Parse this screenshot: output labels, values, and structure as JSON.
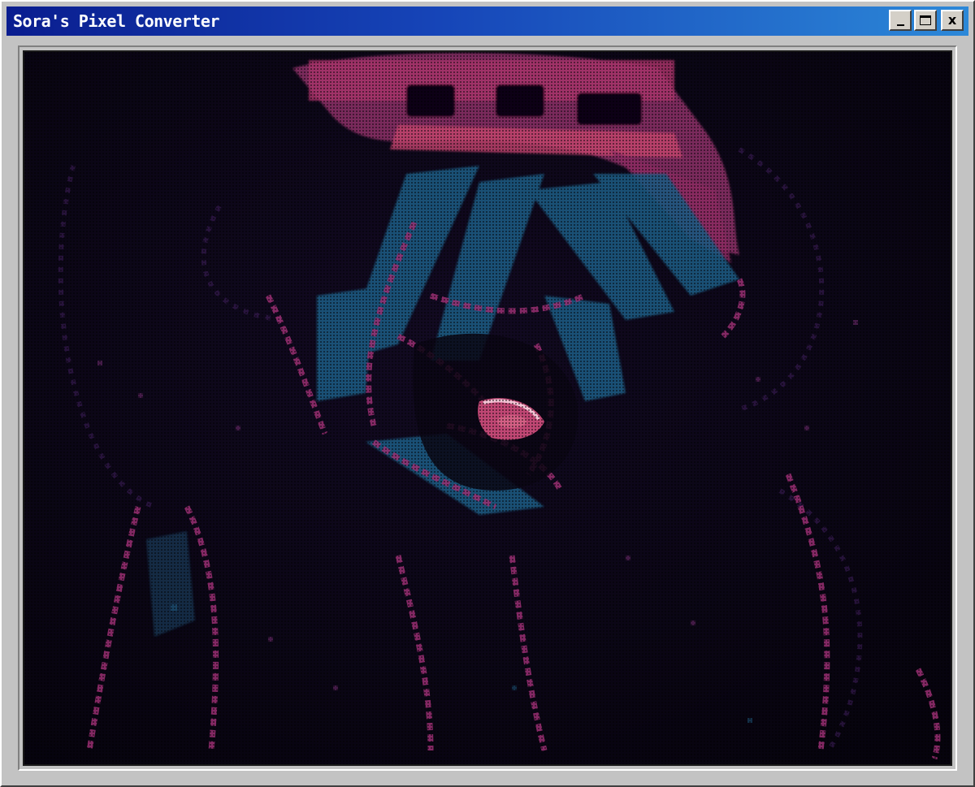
{
  "window": {
    "title": "Sora's Pixel Converter",
    "controls": {
      "minimize": "minimize-icon",
      "maximize": "maximize-icon",
      "close": "close-icon",
      "close_glyph": "x"
    }
  },
  "canvas": {
    "content": "pixelated-converted-image",
    "palette": {
      "background": "#07040f",
      "magenta": "#a0306e",
      "pink": "#e0527e",
      "teal": "#1f5a80",
      "highlight": "#f0c0d0"
    }
  }
}
